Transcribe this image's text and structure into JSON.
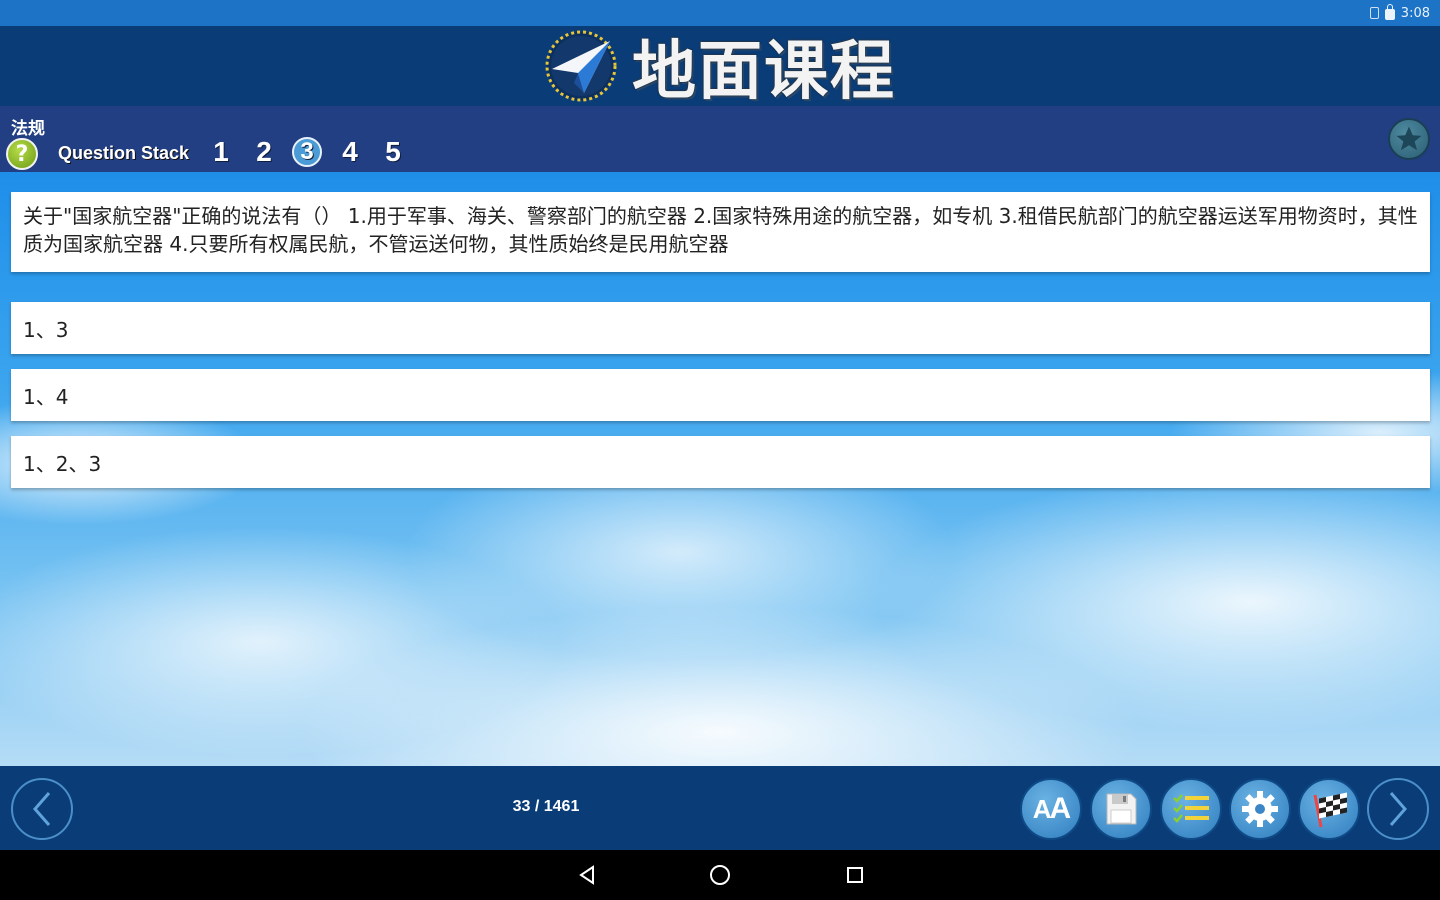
{
  "status_bar": {
    "time": "3:08"
  },
  "header": {
    "title": "地面课程"
  },
  "subheader": {
    "category": "法规",
    "help_label": "?",
    "question_stack_label": "Question Stack",
    "question_numbers": [
      "1",
      "2",
      "3",
      "4",
      "5"
    ],
    "active_question": "3"
  },
  "question": {
    "text": "关于\"国家航空器\"正确的说法有（） 1.用于军事、海关、警察部门的航空器 2.国家特殊用途的航空器，如专机 3.租借民航部门的航空器运送军用物资时，其性质为国家航空器 4.只要所有权属民航，不管运送何物，其性质始终是民用航空器"
  },
  "answers": [
    "1、3",
    "1、4",
    "1、2、3"
  ],
  "bottom_bar": {
    "page_counter": "33 / 1461",
    "font_size_label_large": "A",
    "font_size_label_small": "A"
  },
  "colors": {
    "status_bar": "#1d73c6",
    "header": "#0a3d78",
    "subheader": "#223f84",
    "tool_button": "#3f8ccb",
    "help_green": "#8bbb24"
  }
}
